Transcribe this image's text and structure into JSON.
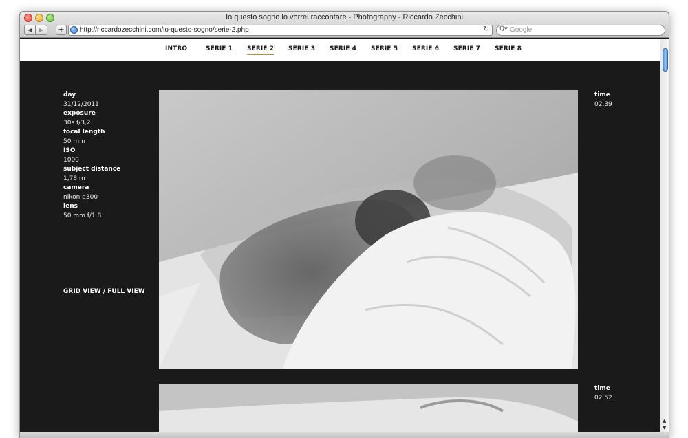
{
  "window": {
    "title": "Io questo sogno lo vorrei raccontare - Photography - Riccardo Zecchini"
  },
  "toolbar": {
    "back_icon": "back-arrow-icon",
    "back_glyph": "◀",
    "forward_glyph": "▶",
    "add_glyph": "+",
    "url": "http://riccardozecchini.com/io-questo-sogno/serie-2.php",
    "reload_glyph": "↻",
    "search_glyph": "Q▾",
    "search_placeholder": "Google"
  },
  "menu": {
    "items": [
      {
        "label": "INTRO"
      },
      {
        "label": "SERIE 1"
      },
      {
        "label": "SERIE 2",
        "active": true
      },
      {
        "label": "SERIE 3"
      },
      {
        "label": "SERIE 4"
      },
      {
        "label": "SERIE 5"
      },
      {
        "label": "SERIE 6"
      },
      {
        "label": "SERIE 7"
      },
      {
        "label": "SERIE 8"
      }
    ],
    "accent_color": "#c98a2a"
  },
  "metadata": {
    "day_label": "day",
    "day_value": "31/12/2011",
    "exposure_label": "exposure",
    "exposure_value": "30s f/3,2",
    "focal_label": "focal length",
    "focal_value": "50 mm",
    "iso_label": "ISO",
    "iso_value": "1000",
    "distance_label": "subject distance",
    "distance_value": "1,78 m",
    "camera_label": "camera",
    "camera_value": "nikon d300",
    "lens_label": "lens",
    "lens_value": "50 mm f/1.8"
  },
  "view_links": {
    "grid": "GRID VIEW",
    "separator": " / ",
    "full": "FULL VIEW"
  },
  "photos": [
    {
      "time_label": "time",
      "time_value": "02.39"
    },
    {
      "time_label": "time",
      "time_value": "02.52"
    }
  ],
  "scrollbar": {
    "up_glyph": "▲",
    "down_glyph": "▼"
  },
  "colors": {
    "page_background": "#1a1a1a",
    "menu_background": "#ffffff",
    "text": "#ffffff"
  }
}
